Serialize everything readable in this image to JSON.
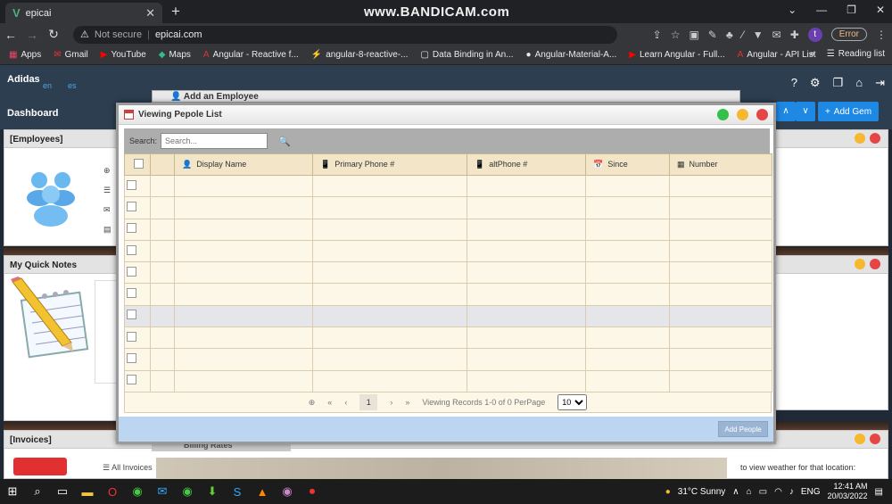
{
  "browser": {
    "tab_title": "epicai",
    "watermark": "www.BANDICAM.com",
    "security": "Not secure",
    "url": "epicai.com",
    "error_label": "Error",
    "profile_initial": "t",
    "bookmarks": [
      "Apps",
      "Gmail",
      "YouTube",
      "Maps",
      "Angular - Reactive f...",
      "angular-8-reactive-...",
      "Data Binding in An...",
      "Angular-Material-A...",
      "Learn Angular - Full...",
      "Angular - API List"
    ],
    "reading_list": "Reading list"
  },
  "app": {
    "brand": "Adidas",
    "lang_en": "en",
    "lang_es": "es",
    "dashboard": "Dashboard",
    "add_gem": "Add Gem",
    "employees_panel": "[Employees]",
    "quick_notes_panel": "My Quick Notes",
    "invoices_panel": "[Invoices]",
    "all_invoices": "All Invoices",
    "add_employee_modal": "Add an Employee",
    "billing_rates": "Billing Rates",
    "weather_hint": "to view weather for that location:"
  },
  "modal": {
    "title": "Viewing Pepole List",
    "search_label": "Search:",
    "search_placeholder": "Search...",
    "columns": [
      "Display Name",
      "Primary Phone #",
      "altPhone #",
      "Since",
      "Number"
    ],
    "page_number": "1",
    "records_text": "Viewing Records 1-0 of 0 PerPage",
    "per_page": "10",
    "add_people": "Add People"
  },
  "taskbar": {
    "weather": "31°C Sunny",
    "lang": "ENG",
    "time": "12:41 AM",
    "date": "20/03/2022"
  },
  "colors": {
    "accent": "#1e88e5",
    "header_bg": "#2c3e50",
    "dot_yellow": "#f5b82e",
    "dot_red": "#e64545",
    "dot_green": "#35c04b"
  }
}
